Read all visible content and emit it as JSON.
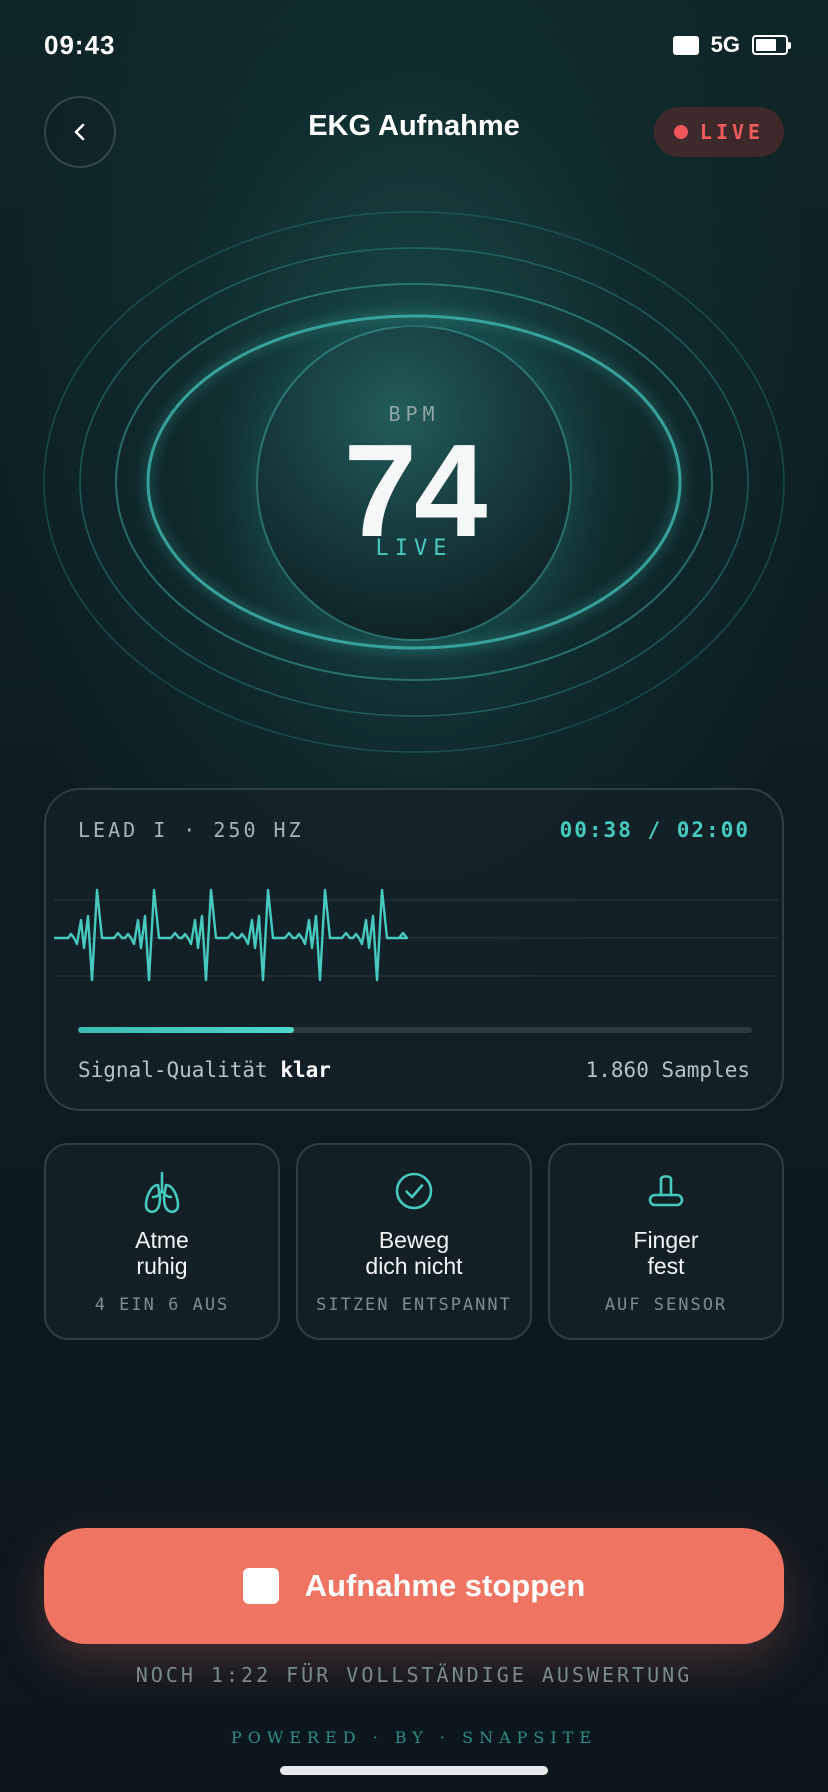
{
  "status_bar": {
    "time": "09:43",
    "network": "5G"
  },
  "header": {
    "title": "EKG Aufnahme",
    "live_badge": "LIVE"
  },
  "heart_rate": {
    "label": "BPM",
    "value": "74",
    "state": "LIVE"
  },
  "ecg": {
    "lead_info": "LEAD I · 250 HZ",
    "timer": "00:38 / 02:00",
    "progress": 0.32,
    "signal_label": "Signal-Qualität",
    "signal_value": "klar",
    "samples": "1.860 Samples"
  },
  "tips": [
    {
      "icon": "lungs-icon",
      "title_line1": "Atme",
      "title_line2": "ruhig",
      "subtitle": "4 EIN 6 AUS"
    },
    {
      "icon": "check-circle-icon",
      "title_line1": "Beweg",
      "title_line2": "dich nicht",
      "subtitle": "SITZEN ENTSPANNT"
    },
    {
      "icon": "finger-sensor-icon",
      "title_line1": "Finger",
      "title_line2": "fest",
      "subtitle": "AUF SENSOR"
    }
  ],
  "stop_button": {
    "label": "Aufnahme stoppen"
  },
  "remaining_text": "NOCH 1:22 FÜR VOLLSTÄNDIGE AUSWERTUNG",
  "footer": "POWERED · BY · SNAPSITE",
  "colors": {
    "accent": "#46c9be",
    "stop": "#ef7461",
    "live": "#ef5b5b"
  }
}
